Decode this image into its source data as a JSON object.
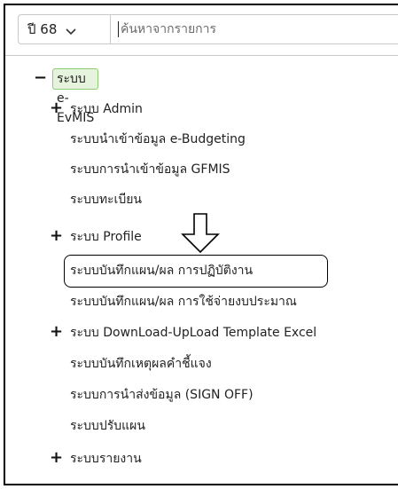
{
  "search": {
    "year_label": "ปี 68",
    "placeholder": "ค้นหาจากรายการ"
  },
  "tree": {
    "root": {
      "toggle": "−",
      "label": "ระบบ e-EvMIS"
    },
    "items": [
      {
        "toggle": "+",
        "label": "ระบบ Admin"
      },
      {
        "toggle": "",
        "label": "ระบบนำเข้าข้อมูล e-Budgeting"
      },
      {
        "toggle": "",
        "label": "ระบบการนำเข้าข้อมูล GFMIS"
      },
      {
        "toggle": "",
        "label": "ระบบทะเบียน"
      },
      {
        "toggle": "+",
        "label": "ระบบ Profile"
      },
      {
        "toggle": "",
        "label": "ระบบบันทึกแผน/ผล การปฏิบัติงาน"
      },
      {
        "toggle": "",
        "label": "ระบบบันทึกแผน/ผล การใช้จ่ายงบประมาณ"
      },
      {
        "toggle": "+",
        "label": "ระบบ DownLoad-UpLoad Template Excel"
      },
      {
        "toggle": "",
        "label": "ระบบบันทึกเหตุผลคำชี้แจง"
      },
      {
        "toggle": "",
        "label": "ระบบการนำส่งข้อมูล (SIGN OFF)"
      },
      {
        "toggle": "",
        "label": "ระบบปรับแผน"
      },
      {
        "toggle": "+",
        "label": "ระบบรายงาน"
      }
    ]
  },
  "icons": {
    "year_dropdown": "chevron-down-icon",
    "annotation": "down-arrow-icon"
  }
}
